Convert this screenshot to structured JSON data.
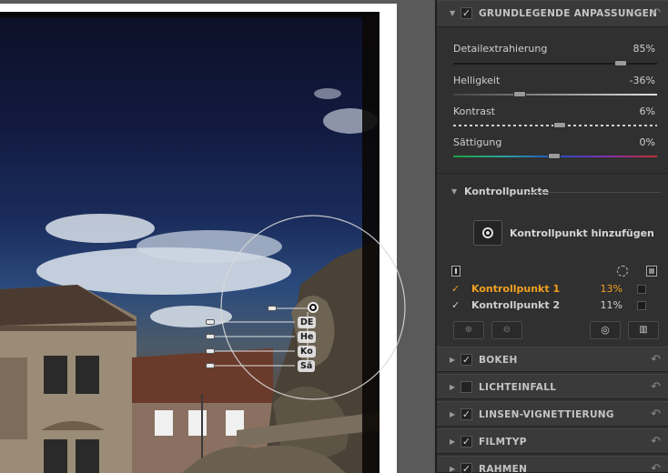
{
  "sections": {
    "basic": {
      "title": "GRUNDLEGENDE ANPASSUNGEN",
      "checked": true,
      "undo_icon": "undo-icon"
    },
    "bokeh": {
      "title": "BOKEH",
      "checked": true
    },
    "lichteinfall": {
      "title": "LICHTEINFALL",
      "checked": false
    },
    "vignette": {
      "title": "LINSEN-VIGNETTIERUNG",
      "checked": true
    },
    "filmtyp": {
      "title": "FILMTYP",
      "checked": true
    },
    "rahmen": {
      "title": "RAHMEN",
      "checked": true
    }
  },
  "sliders": [
    {
      "label": "Detailextrahierung",
      "value": "85%",
      "level": 0.85
    },
    {
      "label": "Helligkeit",
      "value": "-36%",
      "level": 0.32
    },
    {
      "label": "Kontrast",
      "value": "6%",
      "level": 0.53
    },
    {
      "label": "Sättigung",
      "value": "0%",
      "level": 0.5
    }
  ],
  "control_points": {
    "title": "Kontrollpunkte",
    "add_label": "Kontrollpunkt hinzufügen",
    "items": [
      {
        "name": "Kontrollpunkt 1",
        "value": "13%",
        "checked": true,
        "selected": true
      },
      {
        "name": "Kontrollpunkt 2",
        "value": "11%",
        "checked": true,
        "selected": false
      }
    ]
  },
  "overlay": {
    "labels": [
      "DE",
      "He",
      "Ko",
      "Sä"
    ]
  },
  "colors": {
    "accent": "#f0a020",
    "panel_bg": "#303030",
    "header_bg": "#3a3a3a"
  }
}
